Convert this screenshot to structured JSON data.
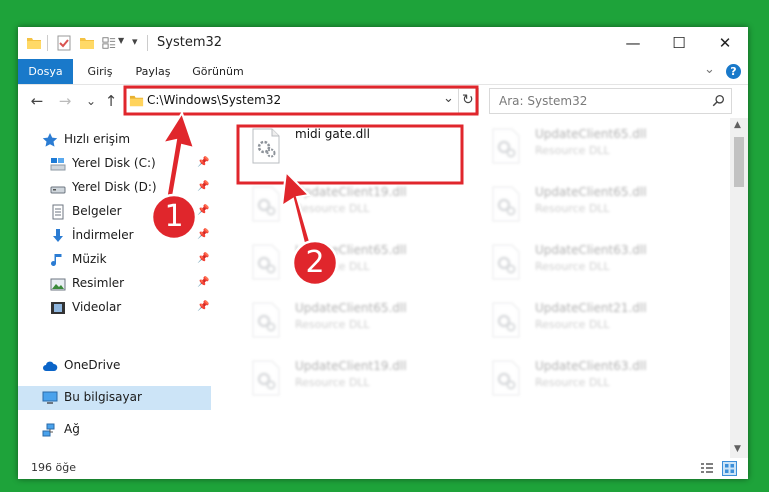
{
  "window": {
    "title": "System32",
    "controls": {
      "minimize": "—",
      "maximize": "☐",
      "close": "✕"
    }
  },
  "ribbon": {
    "tabs": [
      {
        "label": "Dosya"
      },
      {
        "label": "Giriş"
      },
      {
        "label": "Paylaş"
      },
      {
        "label": "Görünüm"
      }
    ],
    "expand_glyph": "⌄",
    "help_glyph": "?"
  },
  "address_bar": {
    "path": "C:\\Windows\\System32",
    "dropdown_glyph": "⌄",
    "refresh_glyph": "↻"
  },
  "search": {
    "placeholder": "Ara: System32"
  },
  "nav_buttons": {
    "back": "←",
    "forward": "→",
    "recent": "⌄",
    "up": "↑"
  },
  "sidebar": {
    "items": [
      {
        "label": "Hızlı erişim",
        "icon": "star-icon",
        "pinned": false
      },
      {
        "label": "Yerel Disk (C:)",
        "icon": "drive-icon",
        "pinned": true
      },
      {
        "label": "Yerel Disk (D:)",
        "icon": "drive-icon",
        "pinned": true
      },
      {
        "label": "Belgeler",
        "icon": "documents-icon",
        "pinned": true
      },
      {
        "label": "İndirmeler",
        "icon": "downloads-icon",
        "pinned": true
      },
      {
        "label": "Müzik",
        "icon": "music-icon",
        "pinned": true
      },
      {
        "label": "Resimler",
        "icon": "pictures-icon",
        "pinned": true
      },
      {
        "label": "Videolar",
        "icon": "videos-icon",
        "pinned": true
      },
      {
        "label": "OneDrive",
        "icon": "cloud-icon",
        "pinned": false
      },
      {
        "label": "Bu bilgisayar",
        "icon": "computer-icon",
        "pinned": false,
        "selected": true
      },
      {
        "label": "Ağ",
        "icon": "network-icon",
        "pinned": false
      }
    ],
    "pin_glyph": "📌"
  },
  "files": [
    {
      "name": "midi gate.dll",
      "type": "",
      "highlighted": true
    },
    {
      "name": "UpdateClient65.dll",
      "type": "Resource DLL"
    },
    {
      "name": "UpdateClient19.dll",
      "type": "Resource DLL"
    },
    {
      "name": "UpdateClient65.dll",
      "type": "Resource DLL"
    },
    {
      "name": "UpdateClient65.dll",
      "type": "Resource DLL"
    },
    {
      "name": "UpdateClient63.dll",
      "type": "Resource DLL"
    },
    {
      "name": "UpdateClient65.dll",
      "type": "Resource DLL"
    },
    {
      "name": "UpdateClient21.dll",
      "type": "Resource DLL"
    },
    {
      "name": "UpdateClient19.dll",
      "type": "Resource DLL"
    },
    {
      "name": "UpdateClient63.dll",
      "type": "Resource DLL"
    }
  ],
  "status": {
    "item_count": "196 öğe"
  },
  "annotations": [
    {
      "number": "1",
      "color": "#e0262c"
    },
    {
      "number": "2",
      "color": "#e0262c"
    }
  ],
  "colors": {
    "accent": "#1979ca",
    "highlight": "#e0262c",
    "background": "#1ea33a",
    "selection": "#cce4f7"
  }
}
